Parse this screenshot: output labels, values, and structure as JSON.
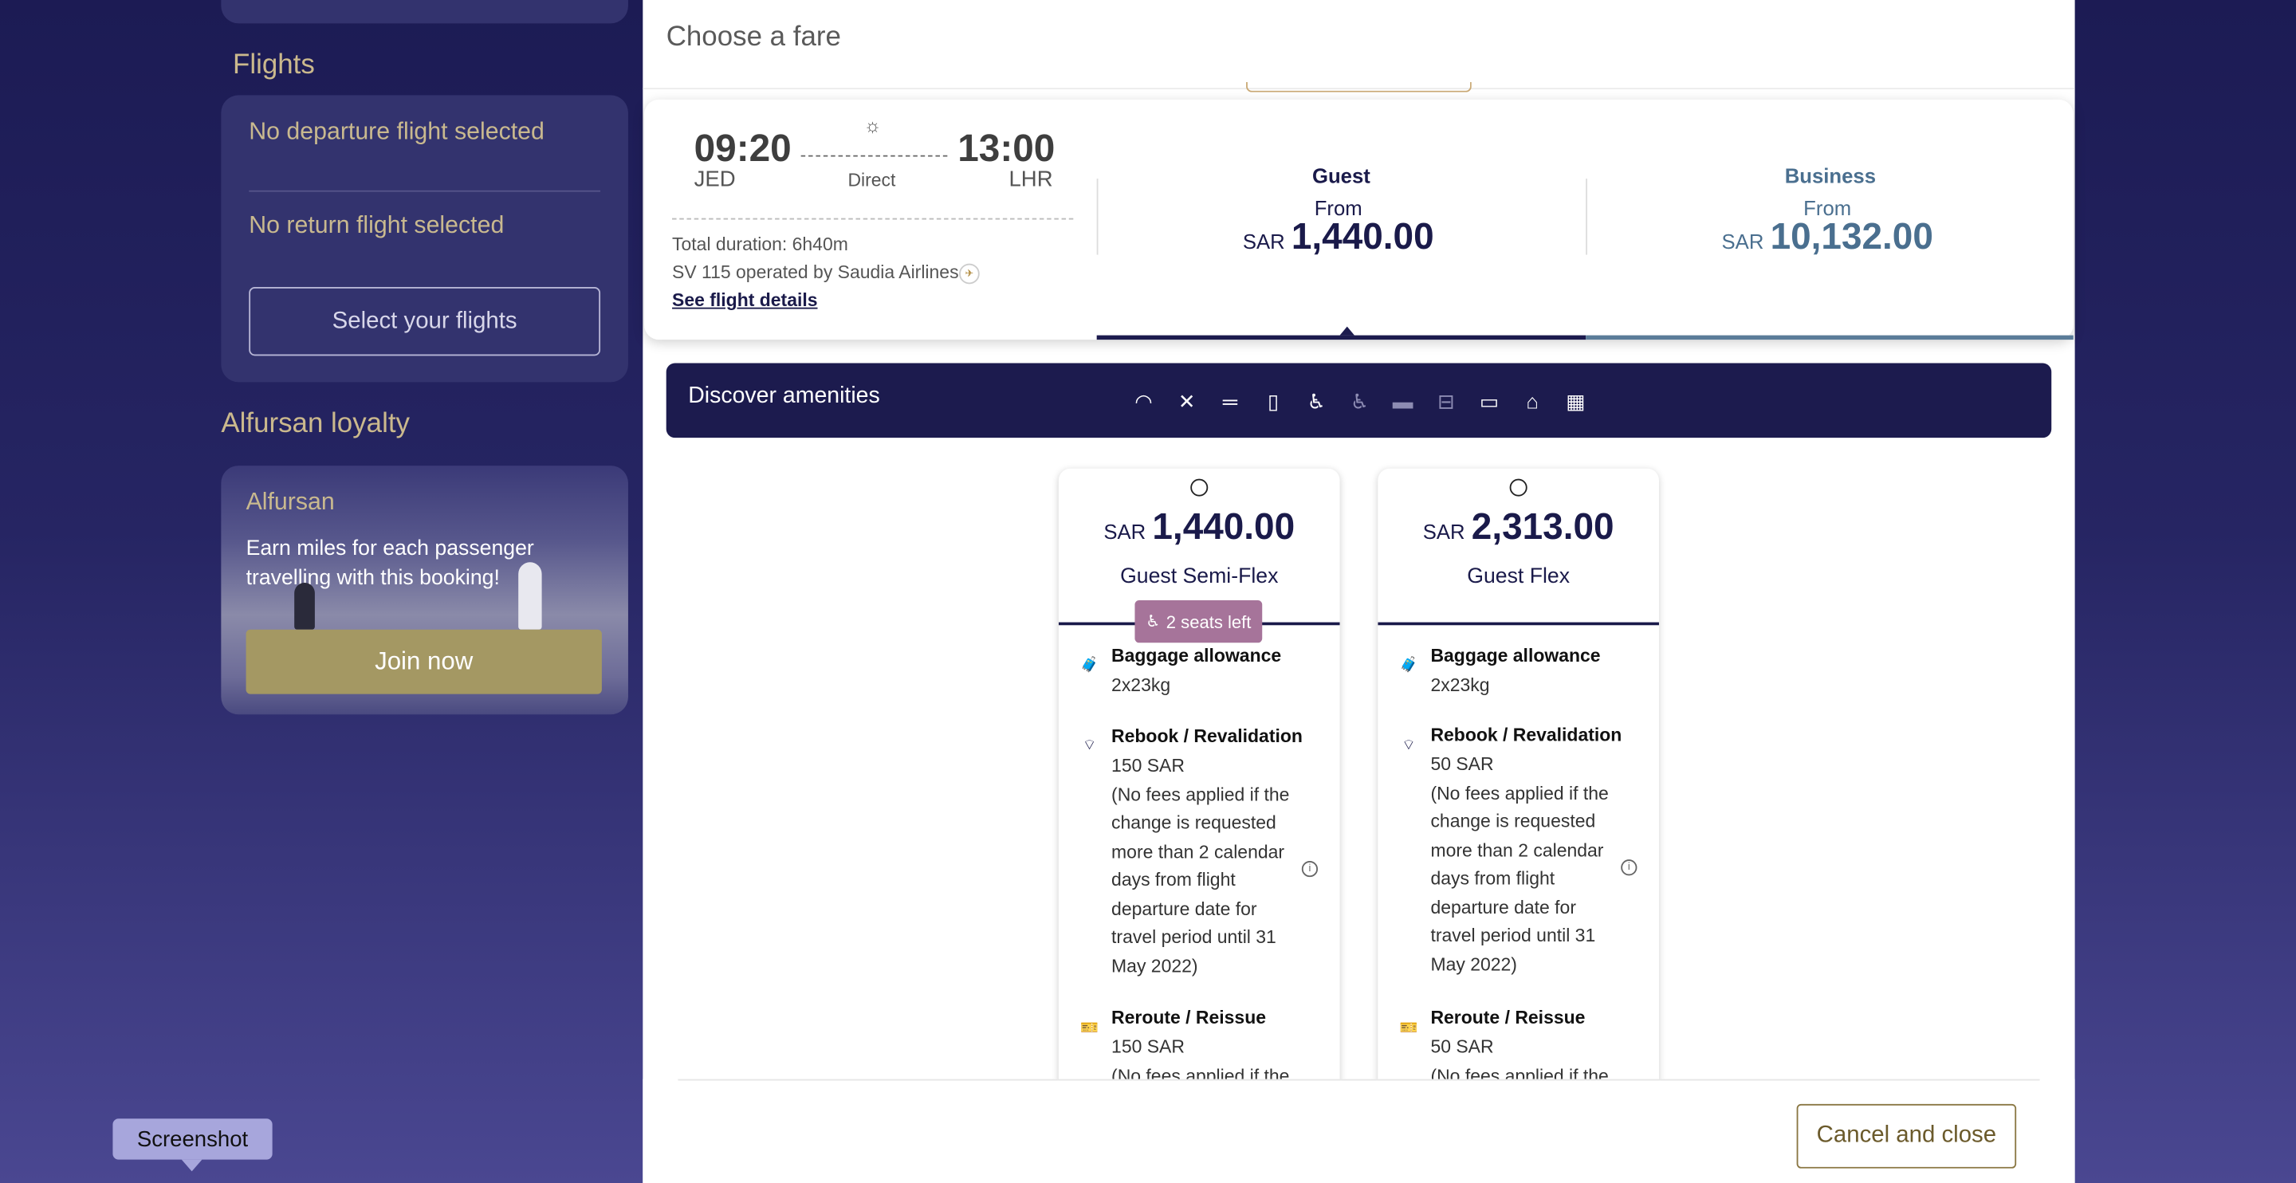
{
  "sidebar": {
    "flights_title": "Flights",
    "departure_text": "No departure flight selected",
    "return_text": "No return flight selected",
    "select_button": "Select your flights",
    "loyalty_title": "Alfursan loyalty",
    "loyalty_card": {
      "title": "Alfursan",
      "line1": "Earn miles for each passenger",
      "line2": "travelling with this booking!",
      "join_button": "Join now"
    }
  },
  "tooltip": "Screenshot",
  "modal": {
    "title": "Choose a fare",
    "flight": {
      "depart_time": "09:20",
      "depart_code": "JED",
      "arrive_time": "13:00",
      "arrive_code": "LHR",
      "stops": "Direct",
      "duration": "Total duration: 6h40m",
      "operator": "SV 115 operated by Saudia Airlines",
      "details_link": "See flight details"
    },
    "cabins": [
      {
        "name": "Guest",
        "from": "From",
        "currency": "SAR",
        "price": "1,440.00",
        "color": "#1a1a4a"
      },
      {
        "name": "Business",
        "from": "From",
        "currency": "SAR",
        "price": "10,132.00",
        "color": "#4a6f8f"
      }
    ],
    "amenities": {
      "title": "Discover amenities",
      "icons": [
        "wifi-icon",
        "meal-icon",
        "power-icon",
        "document-icon",
        "seat-icon",
        "recline-seat-icon",
        "flat-bed-icon",
        "bed-icon",
        "screen-icon",
        "lounge-seat-icon",
        "building-icon"
      ]
    },
    "fares": [
      {
        "currency": "SAR",
        "price": "1,440.00",
        "name": "Guest Semi-Flex",
        "badge": "2 seats left",
        "features": [
          {
            "title": "Baggage allowance",
            "lines": [
              "2x23kg"
            ]
          },
          {
            "title": "Rebook / Revalidation",
            "lines": [
              "150 SAR",
              "(No fees applied if the",
              "change is requested",
              "more than 2 calendar",
              "days from flight",
              "departure date for",
              "travel period until 31",
              "May 2022)"
            ]
          },
          {
            "title": "Reroute / Reissue",
            "lines": [
              "150 SAR",
              "(No fees applied if the"
            ]
          }
        ]
      },
      {
        "currency": "SAR",
        "price": "2,313.00",
        "name": "Guest Flex",
        "badge": "",
        "features": [
          {
            "title": "Baggage allowance",
            "lines": [
              "2x23kg"
            ]
          },
          {
            "title": "Rebook / Revalidation",
            "lines": [
              "50 SAR",
              "(No fees applied if the",
              "change is requested",
              "more than 2 calendar",
              "days from flight",
              "departure date for",
              "travel period until 31",
              "May 2022)"
            ]
          },
          {
            "title": "Reroute / Reissue",
            "lines": [
              "50 SAR",
              "(No fees applied if the"
            ]
          }
        ]
      }
    ],
    "cancel_button": "Cancel and close"
  },
  "colors": {
    "background": "#262563",
    "gold": "#cbb98d",
    "navy": "#1c1b4e",
    "badge": "#a6749a"
  }
}
